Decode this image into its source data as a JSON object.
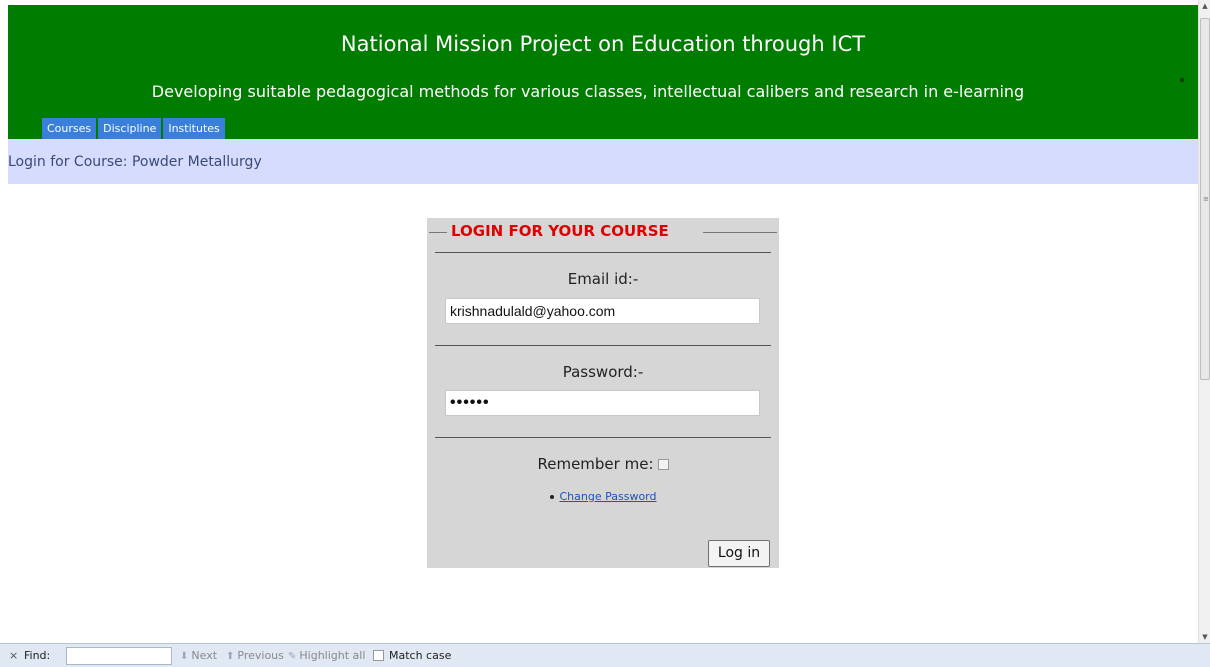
{
  "header": {
    "title": "National Mission Project on Education through ICT",
    "subtitle": "Developing suitable pedagogical methods for various classes, intellectual calibers and research in e-learning",
    "bg_color": "#007d00",
    "nav": [
      {
        "label": "Courses"
      },
      {
        "label": "Discipline"
      },
      {
        "label": "Institutes"
      }
    ]
  },
  "breadcrumb": {
    "text": "Login for Course: Powder Metallurgy"
  },
  "login": {
    "legend": "LOGIN FOR YOUR COURSE",
    "email_label": "Email id:-",
    "email_value": "krishnadulald@yahoo.com",
    "password_label": "Password:-",
    "password_value": "••••••",
    "remember_label": "Remember me:",
    "remember_checked": false,
    "change_password": "Change Password",
    "submit": "Log in"
  },
  "findbar": {
    "close": "×",
    "label": "Find:",
    "value": "",
    "next": "Next",
    "previous": "Previous",
    "highlight_all": "Highlight all",
    "match_case": "Match case"
  },
  "icons": {
    "scroll_up": "chevron-up-icon",
    "scroll_down": "chevron-down-icon",
    "next": "arrow-down-icon",
    "previous": "arrow-up-icon",
    "highlight": "highlighter-icon"
  }
}
